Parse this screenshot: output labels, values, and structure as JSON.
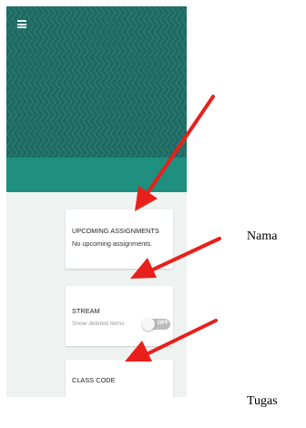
{
  "header": {
    "menu_icon": "hamburger-menu-icon",
    "banner_color": "#1e6a62",
    "band_color": "#1f8f7f"
  },
  "cards": {
    "upcoming": {
      "title": "UPCOMING ASSIGNMENTS",
      "text": "No upcoming assignments."
    },
    "stream": {
      "title": "STREAM",
      "show_deleted_label": "Show deleted items",
      "toggle_state": "OFF"
    },
    "class_code": {
      "title": "CLASS CODE"
    }
  },
  "annotations": {
    "nama": "Nama",
    "tugas": "Tugas",
    "arrow_color": "#e8201b"
  }
}
